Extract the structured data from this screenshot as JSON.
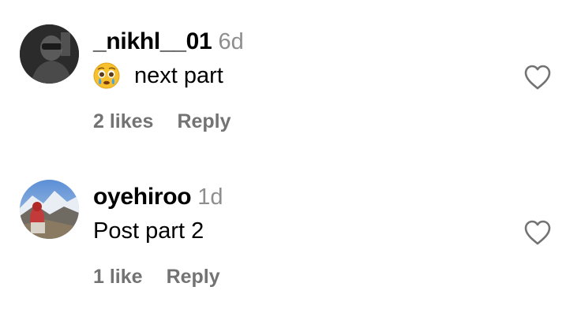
{
  "comments": [
    {
      "username": "_nikhl__01",
      "time": "6d",
      "emoji": "crying-face-emoji",
      "text": "next part",
      "likes": "2 likes",
      "reply_label": "Reply"
    },
    {
      "username": "oyehiroo",
      "time": "1d",
      "text": "Post part 2",
      "likes": "1 like",
      "reply_label": "Reply"
    }
  ],
  "icons": {
    "like": "heart-outline-icon"
  },
  "colors": {
    "secondary_text": "#8e8e8e",
    "action_text": "#737373",
    "primary_text": "#000000"
  }
}
